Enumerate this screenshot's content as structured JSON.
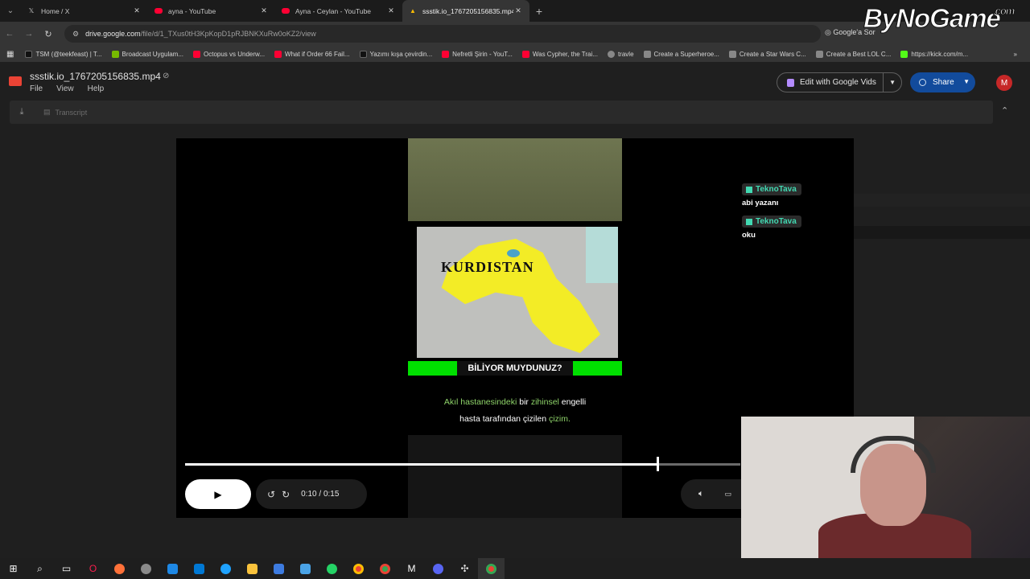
{
  "tabs": [
    {
      "label": "Home / X",
      "icon": "x-logo-icon"
    },
    {
      "label": "ayna - YouTube",
      "icon": "youtube-icon"
    },
    {
      "label": "Ayna - Ceylan - YouTube",
      "icon": "youtube-icon"
    },
    {
      "label": "ssstik.io_1767205156835.mp4 -",
      "icon": "drive-icon"
    }
  ],
  "address": {
    "host": "drive.google.com",
    "path": "/file/d/1_TXus0tH3KpKopD1pRJBNKXuRw0oKZ2/view",
    "search_label": "Google'a Sor"
  },
  "bookmarks": [
    {
      "label": "TSM (@teekfeast) | T...",
      "color": "#111111"
    },
    {
      "label": "Broadcast Uygulam...",
      "color": "#76b900"
    },
    {
      "label": "Octopus vs Underw...",
      "color": "#ff0033"
    },
    {
      "label": "What if Order 66 Fail...",
      "color": "#ff0033"
    },
    {
      "label": "Yazımı kışa çevirdin...",
      "color": "#111111"
    },
    {
      "label": "Nefretli Şirin - YouT...",
      "color": "#ff0033"
    },
    {
      "label": "Was Cypher, the Trai...",
      "color": "#ff0033"
    },
    {
      "label": "travle",
      "color": "#888888"
    },
    {
      "label": "Create a Superheroe...",
      "color": "#888888"
    },
    {
      "label": "Create a Star Wars C...",
      "color": "#888888"
    },
    {
      "label": "Create a Best LOL C...",
      "color": "#888888"
    },
    {
      "label": "https://kick.com/m...",
      "color": "#53fc18"
    }
  ],
  "drive": {
    "file_title": "ssstik.io_1767205156835.mp4",
    "menu": [
      "File",
      "View",
      "Help"
    ],
    "edit_vids_label": "Edit with Google Vids",
    "share_label": "Share",
    "avatar_letter": "M",
    "transcript_label": "Transcript"
  },
  "video": {
    "map_title": "KURDISTAN",
    "banner_text": "BİLİYOR MUYDUNUZ?",
    "caption_line1_a": "Akıl hastanesindeki",
    "caption_line1_b": " bir ",
    "caption_line1_c": "zihinsel",
    "caption_line1_d": " engelli",
    "caption_line2_a": "hasta tarafından çizilen ",
    "caption_line2_b": "çizim.",
    "progress": 0.85,
    "current_time": "0:10",
    "duration": "0:15",
    "time_sep": "/"
  },
  "chat": [
    {
      "user": "TeknoTava",
      "message": "abi yazanı"
    },
    {
      "user": "TeknoTava",
      "message": "oku"
    }
  ],
  "watermark": {
    "main": "ByNoGame",
    "suffix": ".com"
  },
  "taskbar_icons": [
    "windows-start-icon",
    "search-icon",
    "task-view-icon",
    "opera-gx-icon",
    "firefox-icon",
    "app-icon",
    "store-icon",
    "mail-icon",
    "edge-icon",
    "explorer-icon",
    "app-icon",
    "explorer-icon",
    "whatsapp-icon",
    "chrome-icon",
    "chrome-icon",
    "capcut-icon",
    "discord-icon",
    "app-icon",
    "chrome-icon"
  ],
  "colors": {
    "accent_blue": "#124b9c",
    "chat_user": "#42d9b2",
    "banner_green": "#00e000"
  }
}
